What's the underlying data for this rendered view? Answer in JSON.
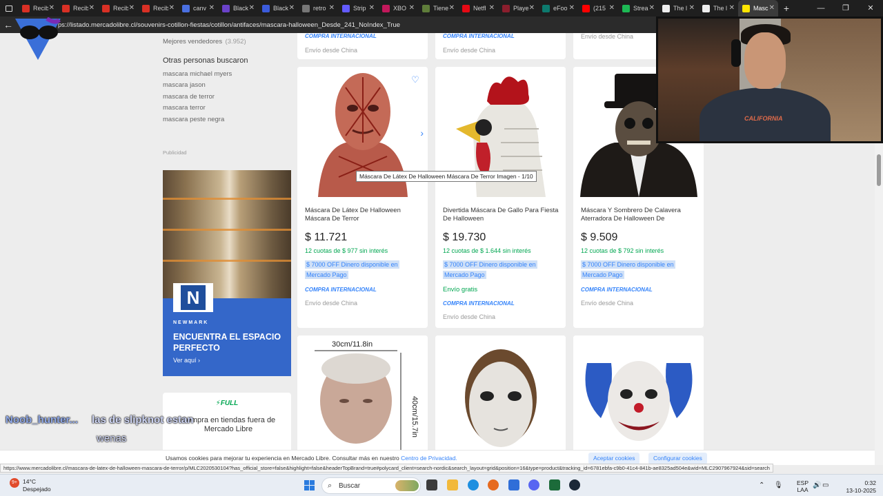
{
  "browser": {
    "tabs": [
      {
        "label": "Recib",
        "color": "#d93025"
      },
      {
        "label": "Recib",
        "color": "#d93025"
      },
      {
        "label": "Recib",
        "color": "#d93025"
      },
      {
        "label": "Recib",
        "color": "#d93025"
      },
      {
        "label": "canv",
        "color": "#4a6fe0"
      },
      {
        "label": "Black",
        "color": "#6a42c9"
      },
      {
        "label": "Black",
        "color": "#3b5bdb"
      },
      {
        "label": "retro",
        "color": "#777777"
      },
      {
        "label": "Strip",
        "color": "#635bff"
      },
      {
        "label": "XBO",
        "color": "#c2185b"
      },
      {
        "label": "Tiene",
        "color": "#5f7d3a"
      },
      {
        "label": "Netfl",
        "color": "#e50914"
      },
      {
        "label": "Playe",
        "color": "#8b1e2d"
      },
      {
        "label": "eFoo",
        "color": "#0d7a6e"
      },
      {
        "label": "(215",
        "color": "#ff0000"
      },
      {
        "label": "Strea",
        "color": "#1db954"
      },
      {
        "label": "The l",
        "color": "#eeeeee"
      },
      {
        "label": "The l",
        "color": "#eeeeee"
      },
      {
        "label": "Masc",
        "color": "#ffe600",
        "active": true
      }
    ],
    "new_tab": "+",
    "url": "ps://listado.mercadolibre.cl/souvenirs-cotillon-fiestas/cotillon/antifaces/mascara-halloween_Desde_241_NoIndex_True"
  },
  "sidebar": {
    "best_sellers_label": "Mejores vendedores",
    "best_sellers_count": "(3.952)",
    "others_title": "Otras personas buscaron",
    "related": [
      "mascara michael myers",
      "mascara jason",
      "mascara de terror",
      "mascara terror",
      "mascara peste negra"
    ],
    "ad_label": "Publicidad",
    "ad": {
      "logo_letter": "N",
      "brand": "NEWMARK",
      "headline": "ENCUENTRA EL ESPACIO PERFECTO",
      "cta": "Ver aquí"
    },
    "full_card": {
      "badge": "⚡FULL",
      "text": "Compra en tiendas fuera de Mercado Libre"
    }
  },
  "top_cards": [
    {
      "line1": "COMPRA INTERNACIONAL",
      "line2": "Envío desde China"
    },
    {
      "line1": "COMPRA INTERNACIONAL",
      "line2": "Envío desde China"
    },
    {
      "line1": "",
      "line2": "Envío desde China"
    }
  ],
  "products": [
    {
      "title": "Máscara De Látex De Halloween Máscara De Terror",
      "price": "$ 11.721",
      "installments": "12 cuotas de $ 977 sin interés",
      "promo_line1": "$ 7000 OFF Dinero disponible en",
      "promo_line2": "Mercado Pago",
      "shipping": "",
      "tag": "COMPRA INTERNACIONAL",
      "origin": "Envío desde China"
    },
    {
      "title": "Divertida Máscara De Gallo Para Fiesta De Halloween",
      "price": "$ 19.730",
      "installments": "12 cuotas de $ 1.644 sin interés",
      "promo_line1": "$ 7000 OFF Dinero disponible en",
      "promo_line2": "Mercado Pago",
      "shipping": "Envío gratis",
      "tag": "COMPRA INTERNACIONAL",
      "origin": "Envío desde China"
    },
    {
      "title": "Máscara Y Sombrero De Calavera Aterradora De Halloween De",
      "price": "$ 9.509",
      "installments": "12 cuotas de $ 792 sin interés",
      "promo_line1": "$ 7000 OFF Dinero disponible en",
      "promo_line2": "Mercado Pago",
      "shipping": "",
      "tag": "COMPRA INTERNACIONAL",
      "origin": "Envío desde China"
    }
  ],
  "bottom_cards": [
    {
      "dim_w": "30cm/11.8in",
      "dim_h": "40cm/15.7in"
    },
    {},
    {}
  ],
  "tooltip": "Máscara De Látex De Halloween Máscara De Terror Imagen - 1/10",
  "cookie": {
    "message": "Usamos cookies para mejorar tu experiencia en Mercado Libre. Consultar más en nuestro ",
    "link": "Centro de Privacidad.",
    "accept": "Aceptar cookies",
    "configure": "Configurar cookies"
  },
  "status_url": "https://www.mercadolibre.cl/mascara-de-latex-de-halloween-mascara-de-terror/p/MLC2020530104?has_official_store=false&highlight=false&headerTopBrand=true#polycard_client=search-nordic&search_layout=grid&position=16&type=product&tracking_id=6781ebfa-c9b0-41c4-841b-ae8325ad504e&wid=MLC2907967924&sid=search",
  "stream": {
    "chat_user": "Noob_hunter...",
    "chat_message": "las de slipknot estan",
    "chat_message2": "wenas",
    "shirt_text": "CALIFORNIA"
  },
  "taskbar": {
    "temperature": "14°C",
    "weather": "Despejado",
    "weather_badge": "9+",
    "search_placeholder": "Buscar",
    "lang1": "ESP",
    "lang2": "LAA",
    "time": "0:32",
    "date": "13-10-2025"
  }
}
